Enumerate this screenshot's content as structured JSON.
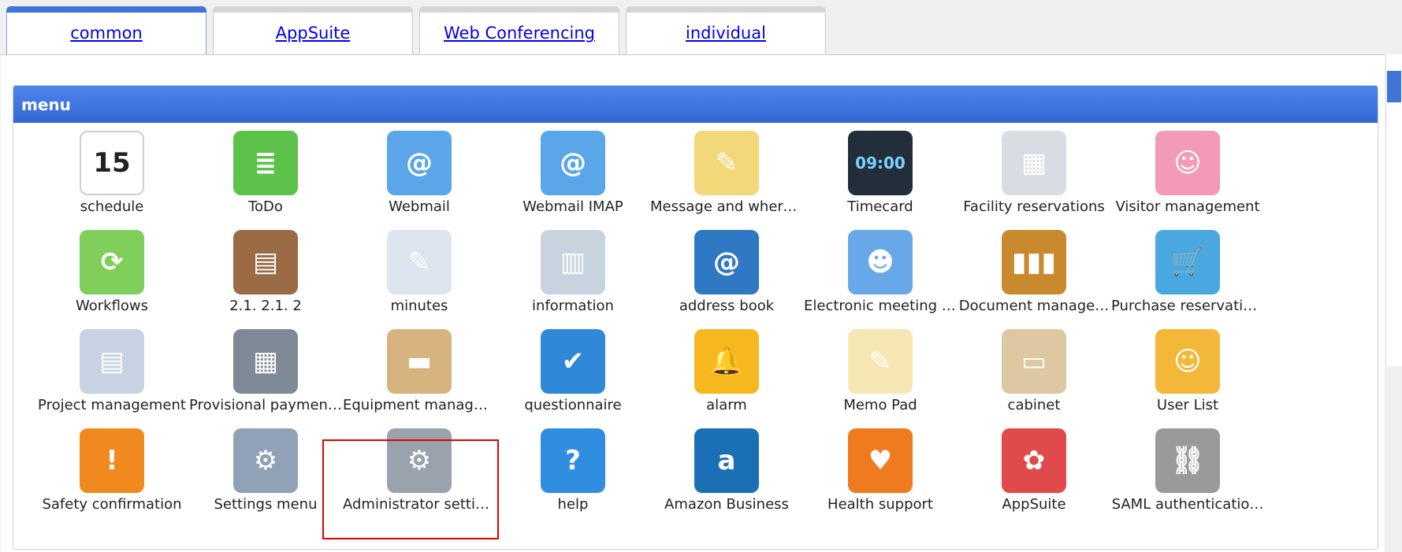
{
  "tabs": [
    {
      "label": "common",
      "active": true
    },
    {
      "label": "AppSuite",
      "active": false
    },
    {
      "label": "Web Conferencing",
      "active": false
    },
    {
      "label": "individual",
      "active": false
    }
  ],
  "panel": {
    "title": "menu"
  },
  "items": [
    {
      "label": "schedule",
      "icon": "calendar-icon",
      "glyph": "15",
      "color": "#ffffff"
    },
    {
      "label": "ToDo",
      "icon": "todo-list-icon",
      "glyph": "≣",
      "color": "#5cc24a"
    },
    {
      "label": "Webmail",
      "icon": "envelope-icon",
      "glyph": "@",
      "color": "#5aa6e8"
    },
    {
      "label": "Webmail IMAP",
      "icon": "envelope-database-icon",
      "glyph": "@",
      "color": "#5aa6e8"
    },
    {
      "label": "Message and where…",
      "icon": "sticky-note-icon",
      "glyph": "✎",
      "color": "#f3d87a"
    },
    {
      "label": "Timecard",
      "icon": "timecard-clock-icon",
      "glyph": "09:00",
      "color": "#222f3a"
    },
    {
      "label": "Facility reservations",
      "icon": "projector-icon",
      "glyph": "▦",
      "color": "#d9dde3"
    },
    {
      "label": "Visitor management",
      "icon": "receptionist-icon",
      "glyph": "☺",
      "color": "#f29ab8"
    },
    {
      "label": "Workflows",
      "icon": "workflow-icon",
      "glyph": "⟳",
      "color": "#7fcf5a"
    },
    {
      "label": "2.1. 2.1. 2",
      "icon": "clipboard-icon",
      "glyph": "▤",
      "color": "#9b6b45"
    },
    {
      "label": "minutes",
      "icon": "notepad-pen-icon",
      "glyph": "✎",
      "color": "#dde6ef"
    },
    {
      "label": "information",
      "icon": "bulletin-board-icon",
      "glyph": "▥",
      "color": "#c7d3de"
    },
    {
      "label": "address book",
      "icon": "address-book-icon",
      "glyph": "@",
      "color": "#2f78c4"
    },
    {
      "label": "Electronic meeting r…",
      "icon": "meeting-people-icon",
      "glyph": "☻",
      "color": "#68a8e8"
    },
    {
      "label": "Document manage…",
      "icon": "binders-icon",
      "glyph": "▮▮▮",
      "color": "#c98a2e"
    },
    {
      "label": "Purchase reservations",
      "icon": "shopping-cart-icon",
      "glyph": "🛒",
      "color": "#4aa8e0"
    },
    {
      "label": "Project management",
      "icon": "gantt-chart-icon",
      "glyph": "▤",
      "color": "#c7d3e2"
    },
    {
      "label": "Provisional paymen…",
      "icon": "calculator-icon",
      "glyph": "▦",
      "color": "#7f8a96"
    },
    {
      "label": "Equipment manage…",
      "icon": "cardboard-box-icon",
      "glyph": "▬",
      "color": "#d7b37f"
    },
    {
      "label": "questionnaire",
      "icon": "checklist-search-icon",
      "glyph": "✔",
      "color": "#2f89d8"
    },
    {
      "label": "alarm",
      "icon": "bell-icon",
      "glyph": "🔔",
      "color": "#f6b81e"
    },
    {
      "label": "Memo Pad",
      "icon": "memo-pad-icon",
      "glyph": "✎",
      "color": "#f6e7b4"
    },
    {
      "label": "cabinet",
      "icon": "file-cabinet-icon",
      "glyph": "▭",
      "color": "#dcc9a1"
    },
    {
      "label": "User List",
      "icon": "user-folder-icon",
      "glyph": "☺",
      "color": "#f3b73a"
    },
    {
      "label": "Safety confirmation",
      "icon": "warning-hand-icon",
      "glyph": "!",
      "color": "#f08a1e"
    },
    {
      "label": "Settings menu",
      "icon": "gear-list-icon",
      "glyph": "⚙",
      "color": "#8fa2b6"
    },
    {
      "label": "Administrator settings",
      "icon": "gear-icon",
      "glyph": "⚙",
      "color": "#9aa3ad"
    },
    {
      "label": "help",
      "icon": "help-question-icon",
      "glyph": "?",
      "color": "#2f8ee0"
    },
    {
      "label": "Amazon Business",
      "icon": "amazon-logo-icon",
      "glyph": "a",
      "color": "#1a6fb5"
    },
    {
      "label": "Health support",
      "icon": "heart-chart-icon",
      "glyph": "♥",
      "color": "#f07a1e"
    },
    {
      "label": "AppSuite",
      "icon": "appsuite-flower-icon",
      "glyph": "✿",
      "color": "#e04a4a"
    },
    {
      "label": "SAML authenticatio…",
      "icon": "saml-link-icon",
      "glyph": "⛓",
      "color": "#9a9a9a"
    }
  ]
}
